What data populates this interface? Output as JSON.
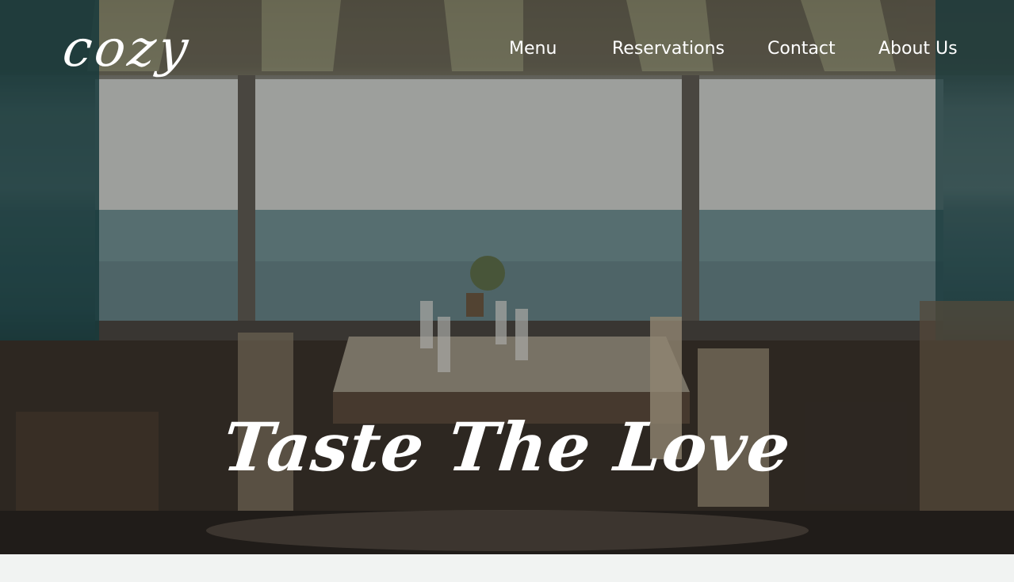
{
  "brand": {
    "logo_text": "cozy"
  },
  "nav": {
    "items": [
      {
        "label": "Menu"
      },
      {
        "label": "Reservations"
      },
      {
        "label": "Contact"
      },
      {
        "label": "About Us"
      }
    ]
  },
  "hero": {
    "headline": "Taste The Love",
    "image_description_icon": "restaurant-seaview-photo"
  },
  "colors": {
    "text": "#ffffff",
    "page_background": "#f1f3f2"
  }
}
